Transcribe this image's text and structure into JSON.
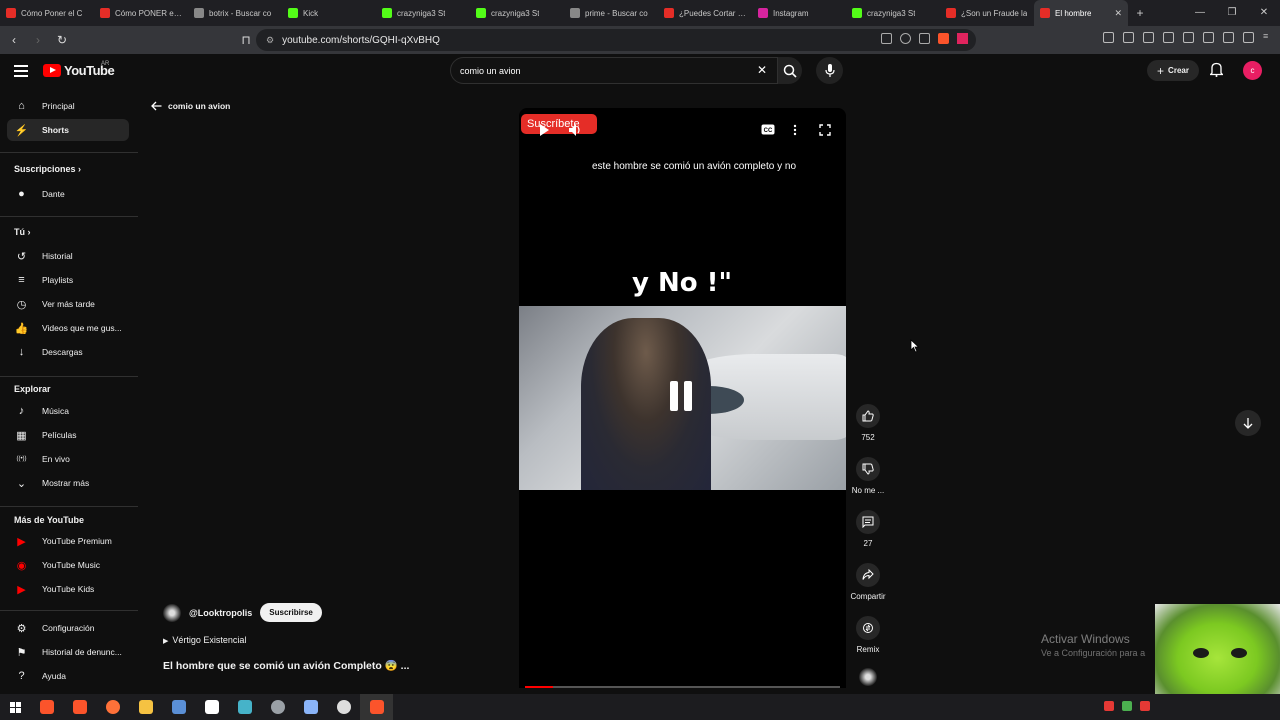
{
  "browser": {
    "tabs": [
      {
        "title": "Cómo Poner el C",
        "color": "#e52d27"
      },
      {
        "title": "Cómo PONER el C",
        "color": "#e52d27"
      },
      {
        "title": "botrix - Buscar co",
        "color": "#888888"
      },
      {
        "title": "Kick",
        "color": "#53fc18"
      },
      {
        "title": "crazyniga3 St",
        "color": "#53fc18"
      },
      {
        "title": "crazyniga3 St",
        "color": "#53fc18"
      },
      {
        "title": "prime - Buscar co",
        "color": "#888888"
      },
      {
        "title": "¿Puedes Cortar Ja",
        "color": "#e52d27"
      },
      {
        "title": "Instagram",
        "color": "#d6249f"
      },
      {
        "title": "crazyniga3 St",
        "color": "#53fc18"
      },
      {
        "title": "¿Son un Fraude la",
        "color": "#e52d27"
      },
      {
        "title": "El hombre",
        "color": "#e52d27"
      }
    ],
    "url": "youtube.com/shorts/GQHI-qXvBHQ"
  },
  "youtube": {
    "logo_text": "YouTube",
    "country_code": "AR",
    "search_value": "comio un avion",
    "create_label": "Crear",
    "avatar_letter": "c"
  },
  "sidebar": {
    "main": [
      {
        "label": "Principal",
        "icon": "home-icon"
      },
      {
        "label": "Shorts",
        "icon": "shorts-icon",
        "active": true
      }
    ],
    "subs_heading": "Suscripciones",
    "subs": [
      {
        "label": "Dante",
        "icon": "channel-avatar"
      }
    ],
    "you_heading": "Tú",
    "you": [
      {
        "label": "Historial",
        "icon": "history-icon"
      },
      {
        "label": "Playlists",
        "icon": "playlist-icon"
      },
      {
        "label": "Ver más tarde",
        "icon": "clock-icon"
      },
      {
        "label": "Videos que me gus...",
        "icon": "thumbs-up-icon"
      },
      {
        "label": "Descargas",
        "icon": "download-icon"
      }
    ],
    "explore_heading": "Explorar",
    "explore": [
      {
        "label": "Música",
        "icon": "music-icon"
      },
      {
        "label": "Películas",
        "icon": "film-icon"
      },
      {
        "label": "En vivo",
        "icon": "live-icon"
      },
      {
        "label": "Mostrar más",
        "icon": "chevron-down-icon"
      }
    ],
    "more_heading": "Más de YouTube",
    "more": [
      {
        "label": "YouTube Premium",
        "icon": "youtube-premium-icon"
      },
      {
        "label": "YouTube Music",
        "icon": "youtube-music-icon"
      },
      {
        "label": "YouTube Kids",
        "icon": "youtube-kids-icon"
      }
    ],
    "bottom": [
      {
        "label": "Configuración",
        "icon": "gear-icon"
      },
      {
        "label": "Historial de denunc...",
        "icon": "flag-icon"
      },
      {
        "label": "Ayuda",
        "icon": "help-icon"
      }
    ]
  },
  "back_label": "comio un avion",
  "video": {
    "subscribe_badge": "Suscríbete",
    "caption": "este hombre se comió un avión completo y no",
    "overlay_text": "y No !\"",
    "progress": 0.09
  },
  "actions": {
    "likes": "752",
    "dislike": "No me ...",
    "comments": "27",
    "share": "Compartir",
    "remix": "Remix"
  },
  "channel": {
    "handle": "@Looktropolis",
    "subscribe": "Suscribirse",
    "music": "Vértigo Existencial",
    "title": "El hombre que se comió un avión Completo 😨 ..."
  },
  "windows": {
    "activate": "Activar Windows",
    "activate_sub": "Ve a Configuración para a"
  }
}
